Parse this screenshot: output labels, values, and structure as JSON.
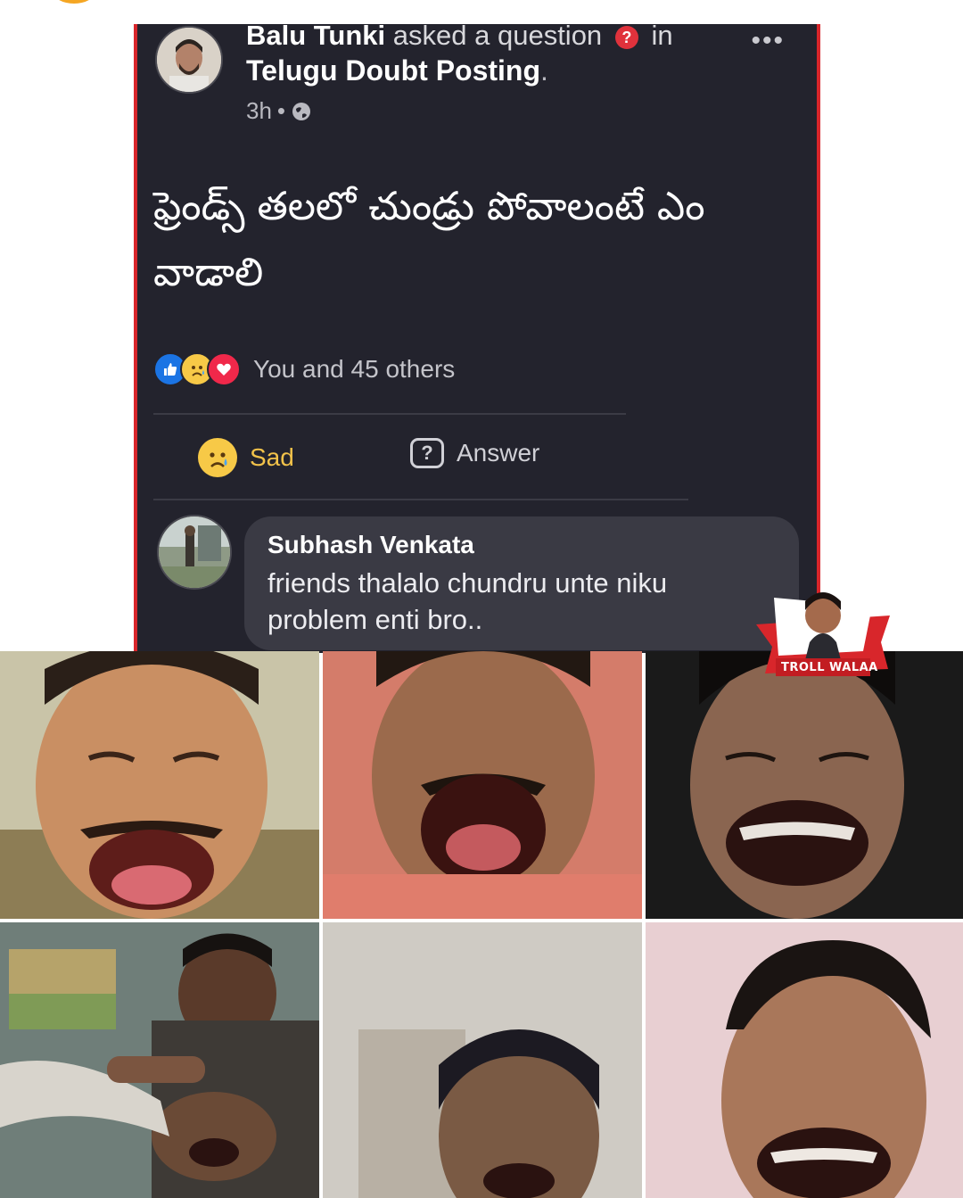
{
  "post": {
    "author": "Balu Tunki",
    "action_text": "asked a question",
    "in_text": "in",
    "group": "Telugu Doubt Posting",
    "group_suffix": ".",
    "time": "3h",
    "separator": "•",
    "question_badge": "?",
    "more_icon": "•••",
    "text": "ఫ్రెండ్స్ తలలో చుండ్రు పోవాలంటే ఎం వాడాలి",
    "reactions": {
      "icons": [
        "like-icon",
        "sad-icon",
        "love-icon"
      ],
      "count_text": "You and 45 others"
    },
    "actions": {
      "sad_label": "Sad",
      "answer_label": "Answer",
      "answer_icon_glyph": "?"
    }
  },
  "comment": {
    "author": "Subhash Venkata",
    "text": "friends thalalo chundru unte niku problem enti bro.."
  },
  "watermark": {
    "label": "TROLL WALAA"
  },
  "colors": {
    "card_bg": "#23232d",
    "card_border": "#d8262b",
    "bubble_bg": "#3a3a44",
    "like_blue": "#1b74e4",
    "sad_yellow": "#f7c947",
    "love_red": "#f0284a"
  },
  "images": {
    "tiles": [
      "laughing-man-1",
      "laughing-man-2",
      "laughing-man-3",
      "laughing-men-4",
      "laughing-man-5",
      "laughing-man-6"
    ]
  }
}
